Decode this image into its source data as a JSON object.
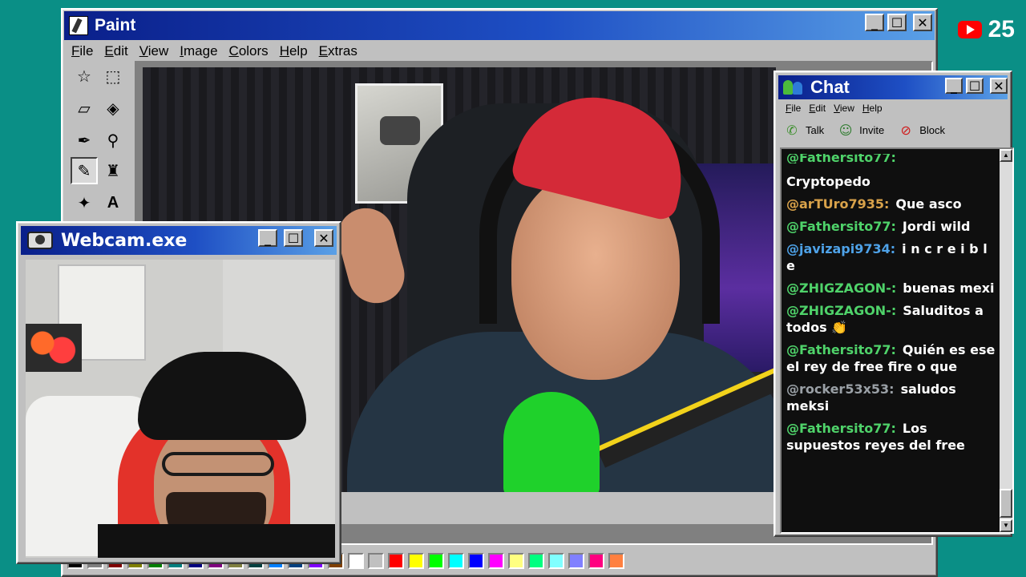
{
  "overlay": {
    "subscriber_count": "25"
  },
  "paint": {
    "title": "Paint",
    "menu": [
      "File",
      "Edit",
      "View",
      "Image",
      "Colors",
      "Help",
      "Extras"
    ],
    "palette": [
      "#000000",
      "#808080",
      "#800000",
      "#808000",
      "#008000",
      "#008080",
      "#000080",
      "#800080",
      "#808040",
      "#004040",
      "#0080ff",
      "#004080",
      "#8000ff",
      "#804000",
      "#ffffff",
      "#c0c0c0",
      "#ff0000",
      "#ffff00",
      "#00ff00",
      "#00ffff",
      "#0000ff",
      "#ff00ff",
      "#ffff80",
      "#00ff80",
      "#80ffff",
      "#8080ff",
      "#ff0080",
      "#ff8040"
    ]
  },
  "webcam": {
    "title": "Webcam.exe"
  },
  "chat": {
    "title": "Chat",
    "menu": [
      "File",
      "Edit",
      "View",
      "Help"
    ],
    "actions": {
      "talk": "Talk",
      "invite": "Invite",
      "block": "Block"
    },
    "partial_top": "@Fathersito77:",
    "messages": [
      {
        "user": "",
        "text": "Cryptopedo",
        "color": "#ffffff"
      },
      {
        "user": "@arTUro7935:",
        "text": "Que asco",
        "color": "#d9a24a"
      },
      {
        "user": "@Fathersito77:",
        "text": "Jordi wild",
        "color": "#4fd36a"
      },
      {
        "user": "@javizapi9734:",
        "text": "i n c r e i b l e",
        "color": "#4ea2e8"
      },
      {
        "user": "@ZHIGZAGON-:",
        "text": "buenas mexi",
        "color": "#4fd36a"
      },
      {
        "user": "@ZHIGZAGON-:",
        "text": "Saluditos a todos 👏",
        "color": "#4fd36a"
      },
      {
        "user": "@Fathersito77:",
        "text": "Quién es ese el rey de free fire o que",
        "color": "#4fd36a"
      },
      {
        "user": "@rocker53x53:",
        "text": "saludos meksi",
        "color": "#9aa0a6"
      },
      {
        "user": "@Fathersito77:",
        "text": "Los supuestos reyes del free",
        "color": "#4fd36a"
      }
    ]
  }
}
